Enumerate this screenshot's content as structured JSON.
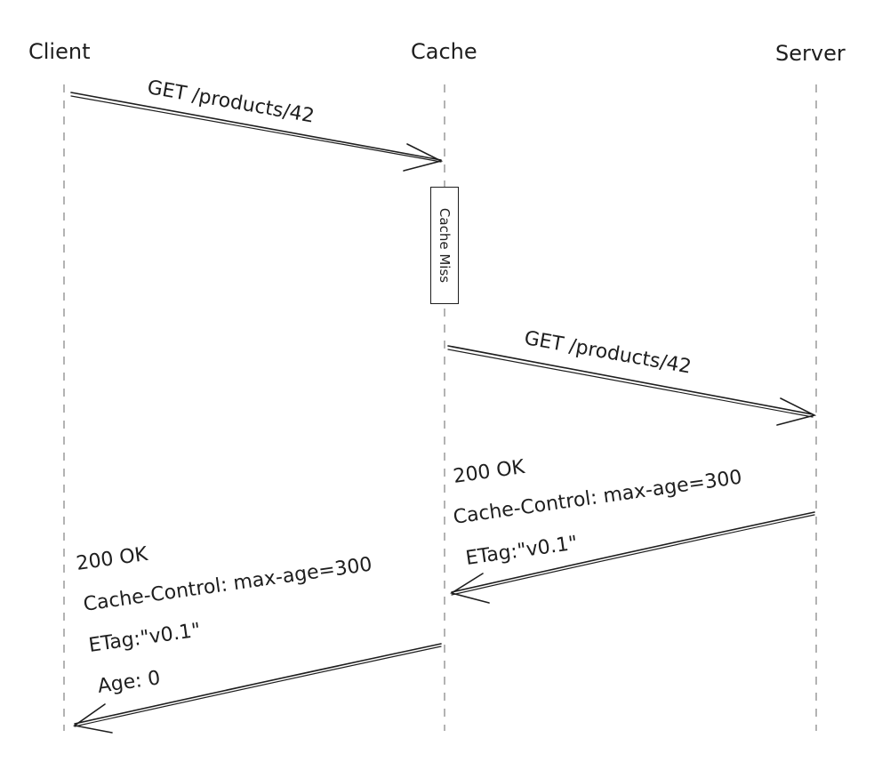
{
  "actors": {
    "client": "Client",
    "cache": "Cache",
    "server": "Server"
  },
  "messages": {
    "m1": "GET /products/42",
    "m2": "GET /products/42",
    "m3": {
      "status": "200 OK",
      "cache_control": "Cache-Control: max-age=300",
      "etag": "ETag:\"v0.1\""
    },
    "m4": {
      "status": "200 OK",
      "cache_control": "Cache-Control: max-age=300",
      "etag": "ETag:\"v0.1\"",
      "age": "Age: 0"
    }
  },
  "note": {
    "text": "Cache Miss"
  },
  "colors": {
    "ink": "#1e1e1e",
    "lifeline": "#9a9a9a"
  }
}
